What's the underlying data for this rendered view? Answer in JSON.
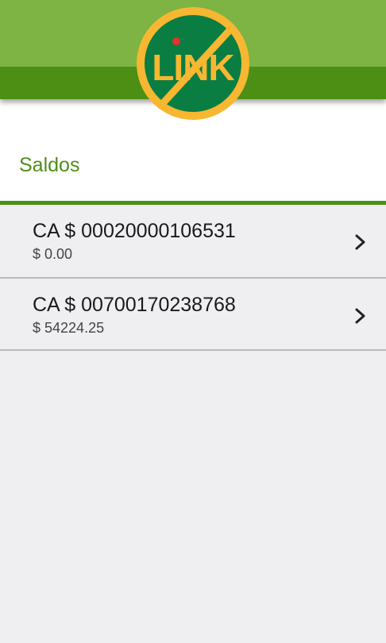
{
  "app": {
    "logo_text": "LINK",
    "colors": {
      "header_light": "#7db443",
      "header_dark": "#4d8f15",
      "logo_ring": "#f7b731",
      "logo_fill": "#0a7d43",
      "logo_dot": "#e2332c",
      "title_green": "#4f8e18"
    }
  },
  "page": {
    "title": "Saldos"
  },
  "accounts": [
    {
      "name": "CA $ 00020000106531",
      "balance": "$ 0.00",
      "icon": "chevron-right-icon"
    },
    {
      "name": "CA $ 00700170238768",
      "balance": "$ 54224.25",
      "icon": "chevron-right-icon"
    }
  ]
}
